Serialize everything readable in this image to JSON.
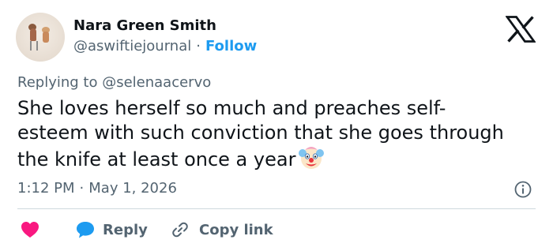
{
  "author": {
    "name": "Nara Green Smith",
    "handle": "@aswiftiejournal",
    "separator": "·",
    "follow_label": "Follow"
  },
  "replying_to": "Replying to @selenaacervo",
  "tweet": {
    "text": "She loves herself so much and preaches self-\nesteem with such conviction that she goes through\nthe knife at least once a year",
    "emoji": "clown-face-icon"
  },
  "meta": {
    "time": "1:12 PM",
    "separator": "·",
    "date": "May 1, 2026"
  },
  "actions": {
    "reply_label": "Reply",
    "copy_link_label": "Copy link"
  },
  "colors": {
    "accent": "#1d9bf0",
    "heart": "#f91880",
    "muted_text": "#536471",
    "text": "#0f1419",
    "divider": "#cfd9de"
  }
}
